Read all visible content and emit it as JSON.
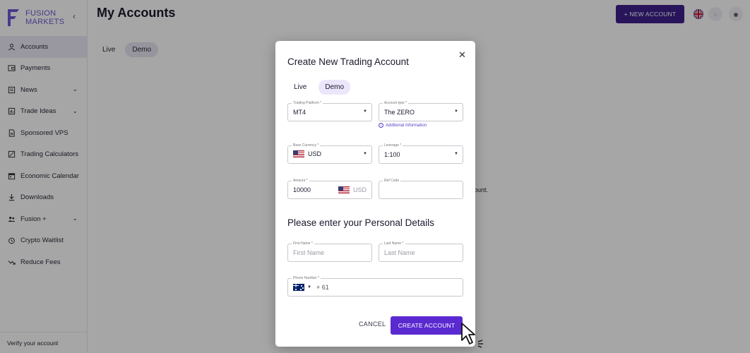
{
  "brand": {
    "name_line1": "FUSION",
    "name_line2": "MARKETS",
    "accent_color": "#6b5bd6"
  },
  "sidebar": {
    "collapse_icon": "chevron-left-icon",
    "items": [
      {
        "label": "Accounts",
        "icon": "person-icon",
        "active": true
      },
      {
        "label": "Payments",
        "icon": "wallet-icon"
      },
      {
        "label": "News",
        "icon": "newspaper-icon",
        "expandable": true
      },
      {
        "label": "Trade Ideas",
        "icon": "chart-icon",
        "expandable": true
      },
      {
        "label": "Sponsored VPS",
        "icon": "document-icon"
      },
      {
        "label": "Trading Calculators",
        "icon": "calculator-icon"
      },
      {
        "label": "Economic Calendar",
        "icon": "calendar-icon"
      },
      {
        "label": "Downloads",
        "icon": "download-icon"
      },
      {
        "label": "Fusion +",
        "icon": "people-icon",
        "expandable": true
      },
      {
        "label": "Crypto Waitlist",
        "icon": "clock-icon"
      },
      {
        "label": "Reduce Fees",
        "icon": "trend-down-icon"
      }
    ],
    "verify_label": "Verify your account"
  },
  "header": {
    "title": "My Accounts",
    "new_account_label": "+ NEW ACCOUNT",
    "new_account_color": "#3c1f8c"
  },
  "bg_tabs": {
    "live": "Live",
    "demo": "Demo"
  },
  "bg_note": "ount.",
  "modal": {
    "title": "Create New Trading Account",
    "tabs": {
      "live": "Live",
      "demo": "Demo",
      "selected": "Demo"
    },
    "trading_platform": {
      "label": "Trading Platform *",
      "value": "MT4"
    },
    "account_type": {
      "label": "Account type *",
      "value": "The ZERO"
    },
    "additional_info": "Additional Information",
    "base_currency": {
      "label": "Base Currency *",
      "value": "USD"
    },
    "leverage": {
      "label": "Leverage *",
      "value": "1:100"
    },
    "amount": {
      "label": "Amount *",
      "value": "10000",
      "currency": "USD"
    },
    "ref_code": {
      "label": "Ref Code",
      "value": ""
    },
    "personal_title": "Please enter your Personal Details",
    "first_name": {
      "label": "First Name *",
      "placeholder": "First Name"
    },
    "last_name": {
      "label": "Last Name *",
      "placeholder": "Last Name"
    },
    "phone": {
      "label": "Phone Number *",
      "prefix": "+ 61"
    },
    "cancel_label": "CANCEL",
    "create_label": "CREATE ACCOUNT",
    "primary_color": "#5a2ad0"
  }
}
